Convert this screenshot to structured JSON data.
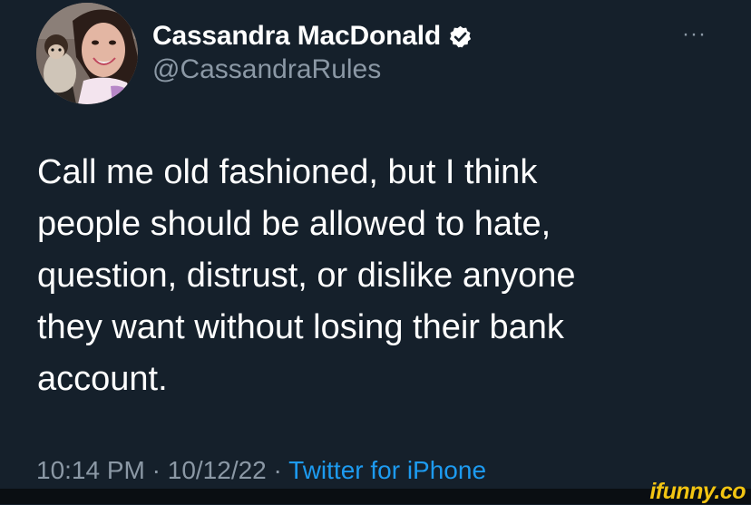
{
  "author": {
    "display_name": "Cassandra MacDonald",
    "handle": "@CassandraRules",
    "verified_icon": "verified-badge-icon",
    "verified_color": "#ffffff"
  },
  "more_label": "···",
  "tweet": {
    "text": "Call me old fashioned, but I think\npeople should be allowed to hate,\nquestion, distrust, or dislike anyone\nthey want without losing their bank\naccount."
  },
  "meta": {
    "time": "10:14 PM",
    "separator_1": " · ",
    "date": "10/12/22",
    "separator_2": " · ",
    "source": "Twitter for iPhone"
  },
  "watermark": "ifunny.co",
  "colors": {
    "background": "#15202b",
    "text": "#ffffff",
    "secondary": "#8b98a5",
    "link": "#1d9bf0",
    "watermark": "#f2c412"
  }
}
